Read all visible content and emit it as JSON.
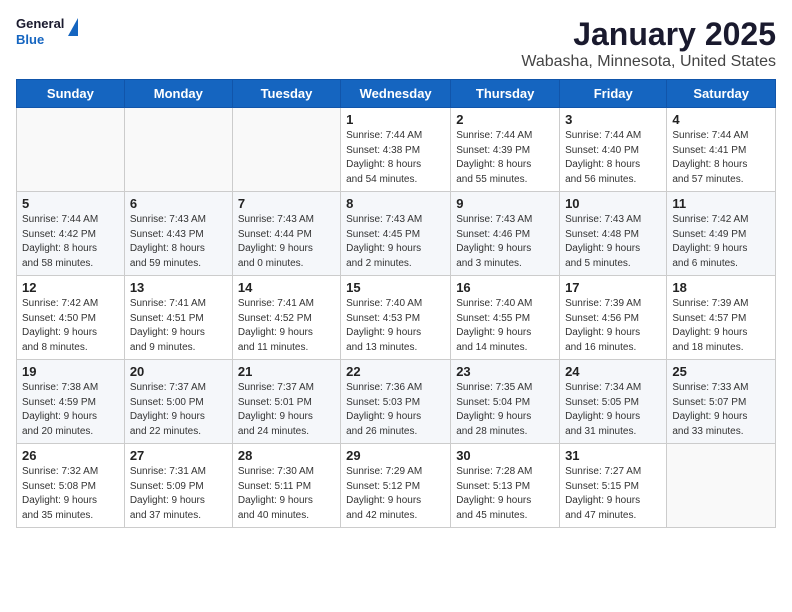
{
  "logo": {
    "general": "General",
    "blue": "Blue"
  },
  "title": "January 2025",
  "subtitle": "Wabasha, Minnesota, United States",
  "headers": [
    "Sunday",
    "Monday",
    "Tuesday",
    "Wednesday",
    "Thursday",
    "Friday",
    "Saturday"
  ],
  "weeks": [
    [
      {
        "num": "",
        "info": ""
      },
      {
        "num": "",
        "info": ""
      },
      {
        "num": "",
        "info": ""
      },
      {
        "num": "1",
        "info": "Sunrise: 7:44 AM\nSunset: 4:38 PM\nDaylight: 8 hours\nand 54 minutes."
      },
      {
        "num": "2",
        "info": "Sunrise: 7:44 AM\nSunset: 4:39 PM\nDaylight: 8 hours\nand 55 minutes."
      },
      {
        "num": "3",
        "info": "Sunrise: 7:44 AM\nSunset: 4:40 PM\nDaylight: 8 hours\nand 56 minutes."
      },
      {
        "num": "4",
        "info": "Sunrise: 7:44 AM\nSunset: 4:41 PM\nDaylight: 8 hours\nand 57 minutes."
      }
    ],
    [
      {
        "num": "5",
        "info": "Sunrise: 7:44 AM\nSunset: 4:42 PM\nDaylight: 8 hours\nand 58 minutes."
      },
      {
        "num": "6",
        "info": "Sunrise: 7:43 AM\nSunset: 4:43 PM\nDaylight: 8 hours\nand 59 minutes."
      },
      {
        "num": "7",
        "info": "Sunrise: 7:43 AM\nSunset: 4:44 PM\nDaylight: 9 hours\nand 0 minutes."
      },
      {
        "num": "8",
        "info": "Sunrise: 7:43 AM\nSunset: 4:45 PM\nDaylight: 9 hours\nand 2 minutes."
      },
      {
        "num": "9",
        "info": "Sunrise: 7:43 AM\nSunset: 4:46 PM\nDaylight: 9 hours\nand 3 minutes."
      },
      {
        "num": "10",
        "info": "Sunrise: 7:43 AM\nSunset: 4:48 PM\nDaylight: 9 hours\nand 5 minutes."
      },
      {
        "num": "11",
        "info": "Sunrise: 7:42 AM\nSunset: 4:49 PM\nDaylight: 9 hours\nand 6 minutes."
      }
    ],
    [
      {
        "num": "12",
        "info": "Sunrise: 7:42 AM\nSunset: 4:50 PM\nDaylight: 9 hours\nand 8 minutes."
      },
      {
        "num": "13",
        "info": "Sunrise: 7:41 AM\nSunset: 4:51 PM\nDaylight: 9 hours\nand 9 minutes."
      },
      {
        "num": "14",
        "info": "Sunrise: 7:41 AM\nSunset: 4:52 PM\nDaylight: 9 hours\nand 11 minutes."
      },
      {
        "num": "15",
        "info": "Sunrise: 7:40 AM\nSunset: 4:53 PM\nDaylight: 9 hours\nand 13 minutes."
      },
      {
        "num": "16",
        "info": "Sunrise: 7:40 AM\nSunset: 4:55 PM\nDaylight: 9 hours\nand 14 minutes."
      },
      {
        "num": "17",
        "info": "Sunrise: 7:39 AM\nSunset: 4:56 PM\nDaylight: 9 hours\nand 16 minutes."
      },
      {
        "num": "18",
        "info": "Sunrise: 7:39 AM\nSunset: 4:57 PM\nDaylight: 9 hours\nand 18 minutes."
      }
    ],
    [
      {
        "num": "19",
        "info": "Sunrise: 7:38 AM\nSunset: 4:59 PM\nDaylight: 9 hours\nand 20 minutes."
      },
      {
        "num": "20",
        "info": "Sunrise: 7:37 AM\nSunset: 5:00 PM\nDaylight: 9 hours\nand 22 minutes."
      },
      {
        "num": "21",
        "info": "Sunrise: 7:37 AM\nSunset: 5:01 PM\nDaylight: 9 hours\nand 24 minutes."
      },
      {
        "num": "22",
        "info": "Sunrise: 7:36 AM\nSunset: 5:03 PM\nDaylight: 9 hours\nand 26 minutes."
      },
      {
        "num": "23",
        "info": "Sunrise: 7:35 AM\nSunset: 5:04 PM\nDaylight: 9 hours\nand 28 minutes."
      },
      {
        "num": "24",
        "info": "Sunrise: 7:34 AM\nSunset: 5:05 PM\nDaylight: 9 hours\nand 31 minutes."
      },
      {
        "num": "25",
        "info": "Sunrise: 7:33 AM\nSunset: 5:07 PM\nDaylight: 9 hours\nand 33 minutes."
      }
    ],
    [
      {
        "num": "26",
        "info": "Sunrise: 7:32 AM\nSunset: 5:08 PM\nDaylight: 9 hours\nand 35 minutes."
      },
      {
        "num": "27",
        "info": "Sunrise: 7:31 AM\nSunset: 5:09 PM\nDaylight: 9 hours\nand 37 minutes."
      },
      {
        "num": "28",
        "info": "Sunrise: 7:30 AM\nSunset: 5:11 PM\nDaylight: 9 hours\nand 40 minutes."
      },
      {
        "num": "29",
        "info": "Sunrise: 7:29 AM\nSunset: 5:12 PM\nDaylight: 9 hours\nand 42 minutes."
      },
      {
        "num": "30",
        "info": "Sunrise: 7:28 AM\nSunset: 5:13 PM\nDaylight: 9 hours\nand 45 minutes."
      },
      {
        "num": "31",
        "info": "Sunrise: 7:27 AM\nSunset: 5:15 PM\nDaylight: 9 hours\nand 47 minutes."
      },
      {
        "num": "",
        "info": ""
      }
    ]
  ]
}
